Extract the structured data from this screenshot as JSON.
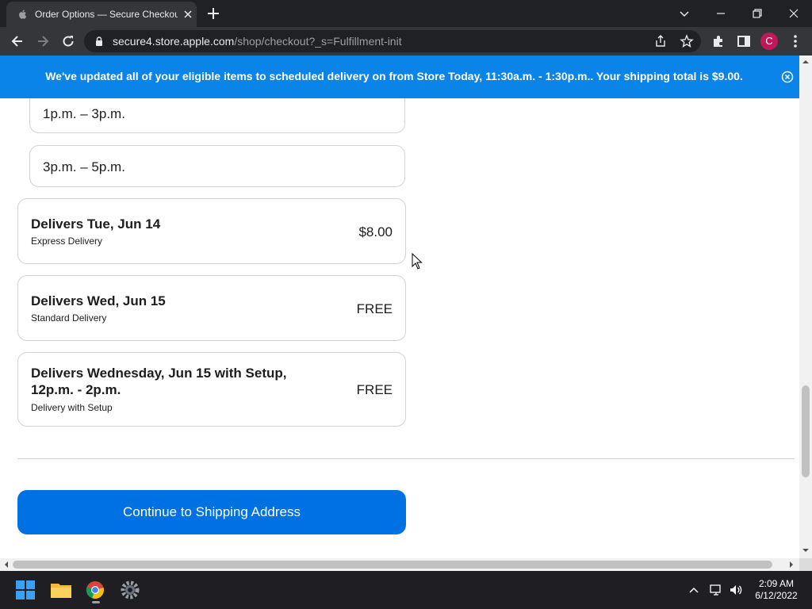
{
  "browser": {
    "tab_title": "Order Options — Secure Checkout",
    "url_host": "secure4.store.apple.com",
    "url_path": "/shop/checkout?_s=Fulfillment-init",
    "profile_initial": "C"
  },
  "banner": {
    "text": "We've updated all of your eligible items to scheduled delivery on from Store Today, 11:30a.m. - 1:30p.m.. Your shipping total is $9.00."
  },
  "time_slots": [
    {
      "label": "1p.m. – 3p.m."
    },
    {
      "label": "3p.m. – 5p.m."
    }
  ],
  "delivery_options": [
    {
      "title": "Delivers Tue, Jun 14",
      "subtitle": "Express Delivery",
      "price": "$8.00"
    },
    {
      "title": "Delivers Wed, Jun 15",
      "subtitle": "Standard Delivery",
      "price": "FREE"
    },
    {
      "title_line1": "Delivers Wednesday, Jun 15 with Setup,",
      "title_line2": "12p.m. - 2p.m.",
      "subtitle": "Delivery with Setup",
      "price": "FREE"
    }
  ],
  "continue_button": {
    "label": "Continue to Shipping Address"
  },
  "taskbar": {
    "time": "2:09 AM",
    "date": "6/12/2022"
  },
  "colors": {
    "banner": "#0a84e8",
    "primary_button": "#0071e3",
    "card_border": "#d2d2d7"
  }
}
